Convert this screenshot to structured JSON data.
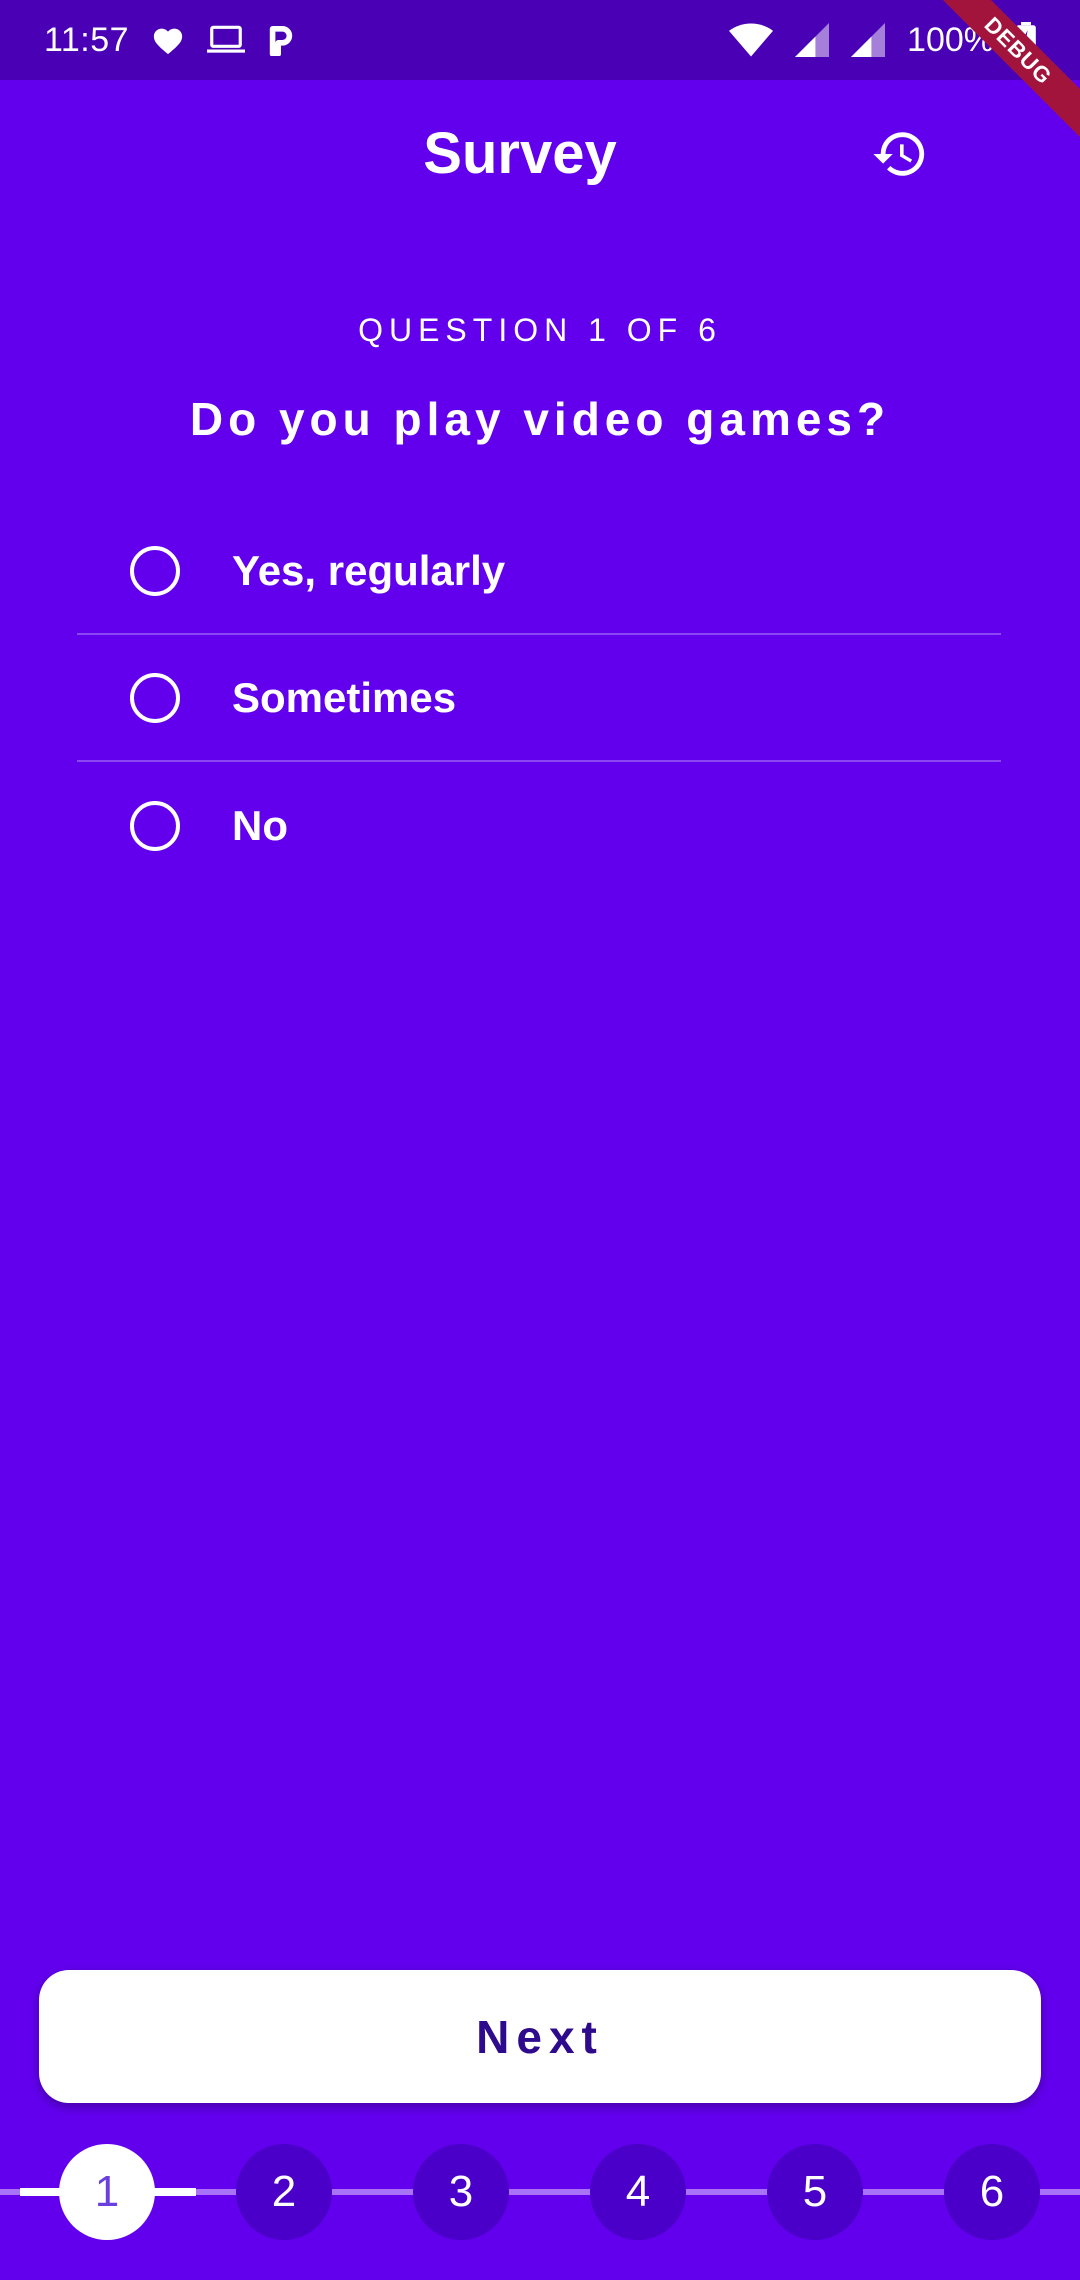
{
  "status_bar": {
    "time": "11:57",
    "battery": "100%",
    "icons": [
      "heart-icon",
      "laptop-icon",
      "parking-icon",
      "wifi-icon",
      "signal-icon",
      "signal-icon",
      "battery-charging-icon"
    ]
  },
  "debug_banner": "DEBUG",
  "app_bar": {
    "title": "Survey",
    "history_icon": "history-icon"
  },
  "question": {
    "counter": "QUESTION 1 OF 6",
    "text": "Do you play video games?",
    "options": [
      {
        "label": "Yes, regularly",
        "selected": false
      },
      {
        "label": "Sometimes",
        "selected": false
      },
      {
        "label": "No",
        "selected": false
      }
    ]
  },
  "next_button": {
    "label": "Next"
  },
  "stepper": {
    "steps": [
      "1",
      "2",
      "3",
      "4",
      "5",
      "6"
    ],
    "current": 1
  },
  "colors": {
    "background": "#6200EE",
    "status_bar": "#4A00B4",
    "step_inactive": "#4A00C8",
    "next_text": "#2E0A8C"
  }
}
